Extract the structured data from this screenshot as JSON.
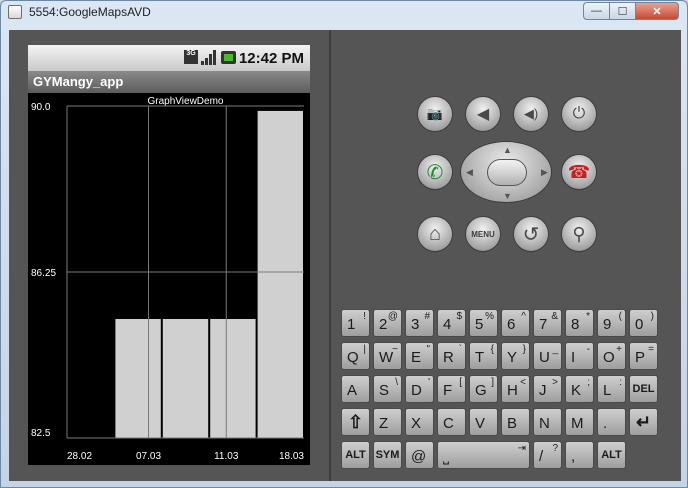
{
  "window": {
    "title": "5554:GoogleMapsAVD",
    "minimize_glyph": "—",
    "maximize_glyph": "☐",
    "close_glyph": "✕"
  },
  "phone": {
    "status": {
      "network": "3G",
      "time": "12:42 PM"
    },
    "app_title": "GYMangy_app"
  },
  "chart_data": {
    "type": "bar",
    "title": "GraphViewDemo",
    "categories": [
      "28.02",
      "07.03",
      "11.03",
      "18.03"
    ],
    "values": [
      82.5,
      85.2,
      85.2,
      85.2,
      89.9
    ],
    "x_tick_labels": [
      "28.02",
      "07.03",
      "11.03",
      "18.03"
    ],
    "y_tick_labels": [
      "90.0",
      "86.25",
      "82.5"
    ],
    "ylim": [
      82.5,
      90.0
    ],
    "grid": true,
    "bar_color": "#d0d0d0",
    "background": "#000000"
  },
  "controls": {
    "top_row": [
      "camera-icon",
      "volume-down-icon",
      "volume-up-icon",
      "power-icon"
    ],
    "mid_row": [
      "call-icon",
      "dpad",
      "end-call-icon"
    ],
    "bottom_row": [
      "home-icon",
      "menu",
      "back-icon",
      "search-icon"
    ],
    "menu_label": "MENU",
    "dpad_arrows": {
      "up": "▲",
      "down": "▼",
      "left": "◀",
      "right": "▶"
    },
    "glyphs": {
      "camera": "📷",
      "vol_down": "◀",
      "vol_up": "◀)",
      "power": "⏻",
      "call": "✆",
      "end_call": "☎",
      "home": "⌂",
      "back": "↺",
      "search": "⚲"
    }
  },
  "keyboard": {
    "row1": [
      [
        "1",
        "!"
      ],
      [
        "2",
        "@"
      ],
      [
        "3",
        "#"
      ],
      [
        "4",
        "$"
      ],
      [
        "5",
        "%"
      ],
      [
        "6",
        "^"
      ],
      [
        "7",
        "&"
      ],
      [
        "8",
        "*"
      ],
      [
        "9",
        "("
      ],
      [
        "0",
        ")"
      ]
    ],
    "row2": [
      [
        "Q",
        "|"
      ],
      [
        "W",
        "~"
      ],
      [
        "E",
        "\""
      ],
      [
        "R",
        "`"
      ],
      [
        "T",
        "{"
      ],
      [
        "Y",
        "}"
      ],
      [
        "U",
        "_"
      ],
      [
        "I",
        "-"
      ],
      [
        "O",
        "+"
      ],
      [
        "P",
        "="
      ]
    ],
    "row3": [
      [
        "A",
        ""
      ],
      [
        "S",
        "\\"
      ],
      [
        "D",
        "'"
      ],
      [
        "F",
        "["
      ],
      [
        "G",
        "]"
      ],
      [
        "H",
        "<"
      ],
      [
        "J",
        ">"
      ],
      [
        "K",
        ";"
      ],
      [
        "L",
        ":"
      ],
      [
        "DEL",
        ""
      ]
    ],
    "row4": [
      [
        "⇧",
        ""
      ],
      [
        "Z",
        ""
      ],
      [
        "X",
        ""
      ],
      [
        "C",
        ""
      ],
      [
        "V",
        ""
      ],
      [
        "B",
        ""
      ],
      [
        "N",
        ""
      ],
      [
        "M",
        ""
      ],
      [
        ".",
        ""
      ],
      [
        "↵",
        ""
      ]
    ],
    "row5": [
      [
        "ALT",
        ""
      ],
      [
        "SYM",
        ""
      ],
      [
        "@",
        ""
      ],
      [
        "⎵",
        "⇥"
      ],
      [
        "/",
        "?"
      ],
      [
        ",",
        ""
      ],
      [
        "ALT",
        ""
      ]
    ]
  }
}
